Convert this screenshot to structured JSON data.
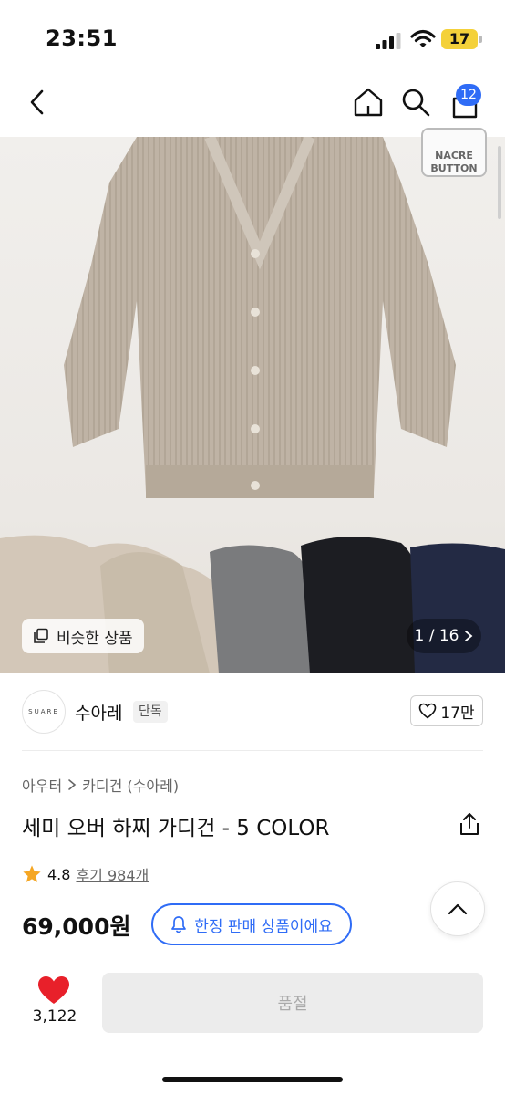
{
  "status": {
    "time": "23:51",
    "battery": "17"
  },
  "nav": {
    "cart_count": "12"
  },
  "image": {
    "badge_line1": "NACRE",
    "badge_line2": "BUTTON",
    "similar_label": "비슷한 상품",
    "counter": "1 / 16"
  },
  "store": {
    "logo_text": "SUARE",
    "name": "수아레",
    "tag": "단독",
    "likes": "17만"
  },
  "product": {
    "breadcrumb": [
      "아우터",
      "카디건 (수아레)"
    ],
    "title": "세미 오버 하찌 가디건 - 5 COLOR",
    "rating": "4.8",
    "reviews": "후기 984개",
    "price": "69,000원",
    "limited_label": "한정 판매 상품이에요"
  },
  "bottom": {
    "like_count": "3,122",
    "soldout_label": "품절"
  },
  "colors": {
    "accent": "#2f6cf6",
    "heart": "#e8202a",
    "star": "#f5a623"
  }
}
